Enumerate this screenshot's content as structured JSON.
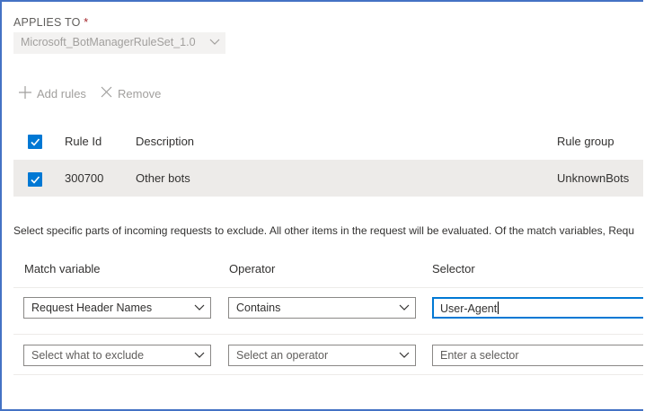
{
  "applies_to": {
    "label": "APPLIES TO",
    "required_marker": "*",
    "selected_value": "Microsoft_BotManagerRuleSet_1.0"
  },
  "toolbar": {
    "add_rules_label": "Add rules",
    "remove_label": "Remove"
  },
  "rules_table": {
    "headers": {
      "rule_id": "Rule Id",
      "description": "Description",
      "rule_group": "Rule group"
    },
    "rows": [
      {
        "rule_id": "300700",
        "description": "Other bots",
        "rule_group": "UnknownBots",
        "checked": true
      }
    ],
    "header_checked": true
  },
  "info_text": "Select specific parts of incoming requests to exclude. All other items in the request will be evaluated. Of the match variables, Requ",
  "exclusions": {
    "headers": {
      "match_variable": "Match variable",
      "operator": "Operator",
      "selector": "Selector"
    },
    "rows": [
      {
        "match_variable": "Request Header Names",
        "operator": "Contains",
        "selector_value": "User-Agent"
      },
      {
        "match_variable_placeholder": "Select what to exclude",
        "operator_placeholder": "Select an operator",
        "selector_placeholder": "Enter a selector"
      }
    ]
  },
  "colors": {
    "accent": "#0078d4",
    "border": "#4472c4",
    "row_highlight": "#edebe9",
    "required": "#a4262c"
  }
}
